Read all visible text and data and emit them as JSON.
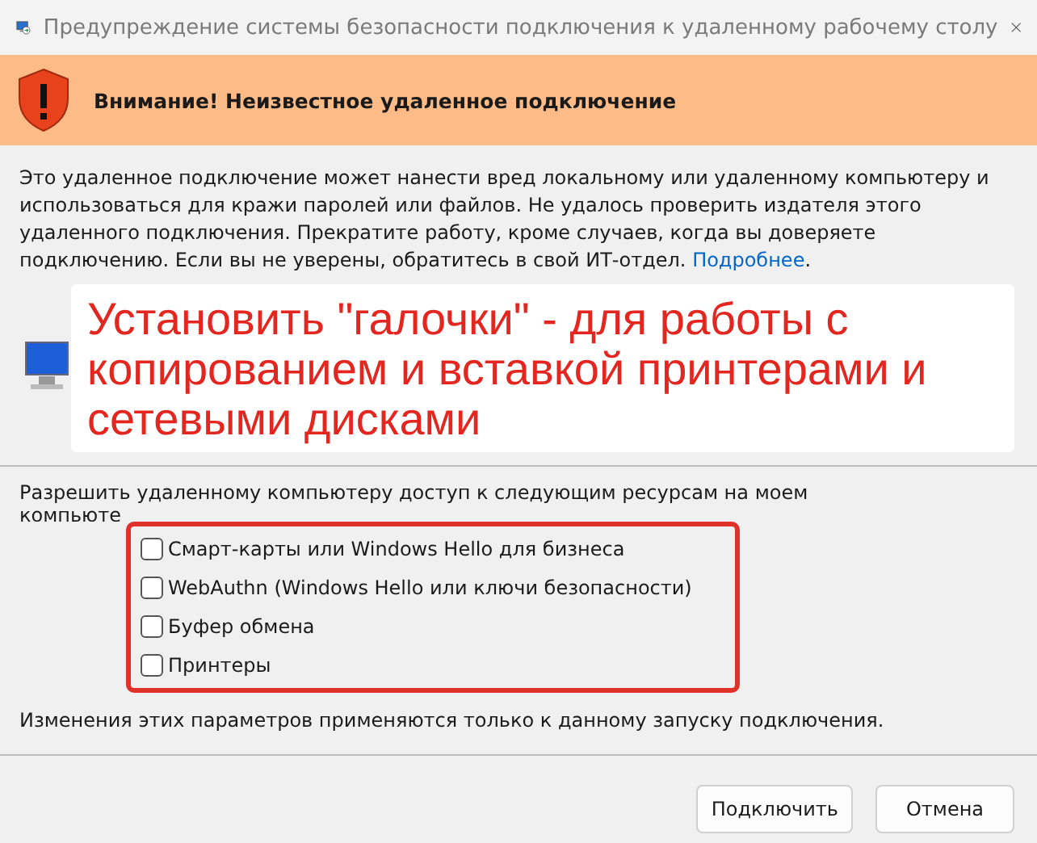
{
  "window": {
    "title": "Предупреждение системы безопасности подключения к удаленному рабочему столу"
  },
  "banner": {
    "text": "Внимание! Неизвестное удаленное подключение"
  },
  "warning": {
    "text": "Это удаленное подключение может нанести вред локальному или удаленному компьютеру и использоваться для кражи паролей или файлов. Не удалось проверить издателя этого удаленного подключения. Прекратите работу, кроме случаев, когда вы доверяете подключению. Если вы не уверены, обратитесь в свой ИТ-отдел.",
    "link": "Подробнее",
    "end": "."
  },
  "annotation": {
    "text": "Установить \"галочки\" - для работы с копированием и вставкой принтерами и сетевыми дисками"
  },
  "resources": {
    "label": "Разрешить удаленному компьютеру доступ к следующим ресурсам на моем",
    "label_cut": "компьюте",
    "items": [
      {
        "label": "Смарт-карты или Windows Hello для бизнеса",
        "checked": false
      },
      {
        "label": "WebAuthn (Windows Hello или ключи безопасности)",
        "checked": false
      },
      {
        "label": "Буфер обмена",
        "checked": false
      },
      {
        "label": "Принтеры",
        "checked": false
      }
    ]
  },
  "note": "Изменения этих параметров применяются только к данному запуску подключения.",
  "buttons": [
    {
      "label": "Подключить"
    },
    {
      "label": "Отмена"
    }
  ]
}
